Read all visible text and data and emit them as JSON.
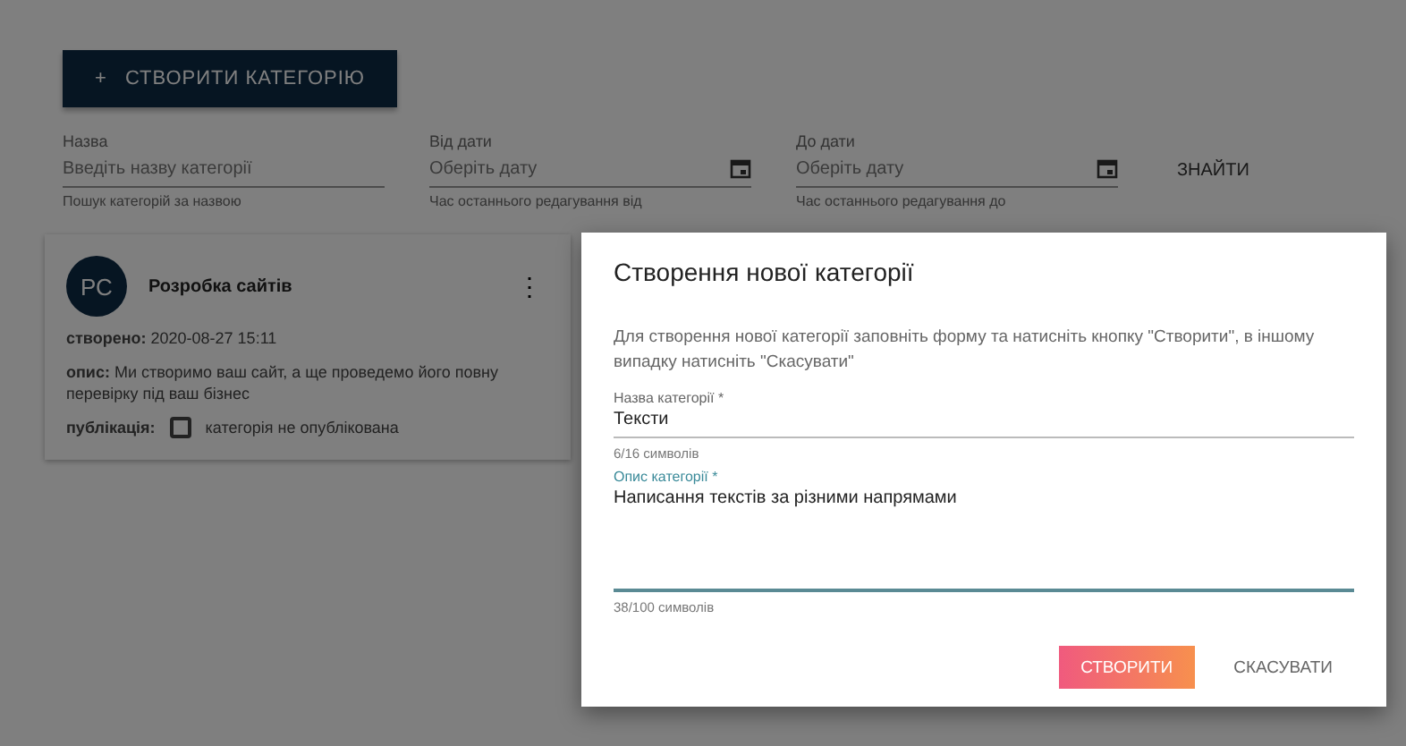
{
  "create_button": {
    "icon": "+",
    "label": "СТВОРИТИ КАТЕГОРІЮ"
  },
  "filters": [
    {
      "kind": "text",
      "label": "Назва",
      "placeholder": "Введіть назву категорії",
      "hint": "Пошук категорій за назвою"
    },
    {
      "kind": "date",
      "label": "Від дати",
      "placeholder": "Оберіть дату",
      "hint": "Час останнього редагування від"
    },
    {
      "kind": "date",
      "label": "До дати",
      "placeholder": "Оберіть дату",
      "hint": "Час останнього редагування до"
    }
  ],
  "search_button": "ЗНАЙТИ",
  "card": {
    "avatar": "РС",
    "title": "Розробка сайтів",
    "menu": "⋮",
    "created": "**створено:** 2020-08-27 15:11",
    "description": "**опис:** Ми створимо ваш сайт, а ще проведемо його повну перевірку під ваш бізнес",
    "published_label": "публікація:",
    "published": false,
    "published_text": "категорія не опублікована"
  },
  "dialog": {
    "title": "Створення нової категорії",
    "text": "Для створення нової категорії заповніть форму та натисніть кнопку \"Створити\", в іншому випадку натисніть \"Скасувати\"",
    "fields": [
      {
        "kind": "input",
        "label": "Назва категорії *",
        "value": "Тексти",
        "helper": "6/16 символів"
      },
      {
        "kind": "textarea",
        "label": "Опис категорії *",
        "value": "Написання текстів за різними напрямами",
        "helper": "38/100 символів"
      }
    ],
    "buttons": [
      {
        "kind": "primary",
        "label": "СТВОРИТИ"
      },
      {
        "kind": "text",
        "label": "СКАСУВАТИ"
      }
    ]
  }
}
